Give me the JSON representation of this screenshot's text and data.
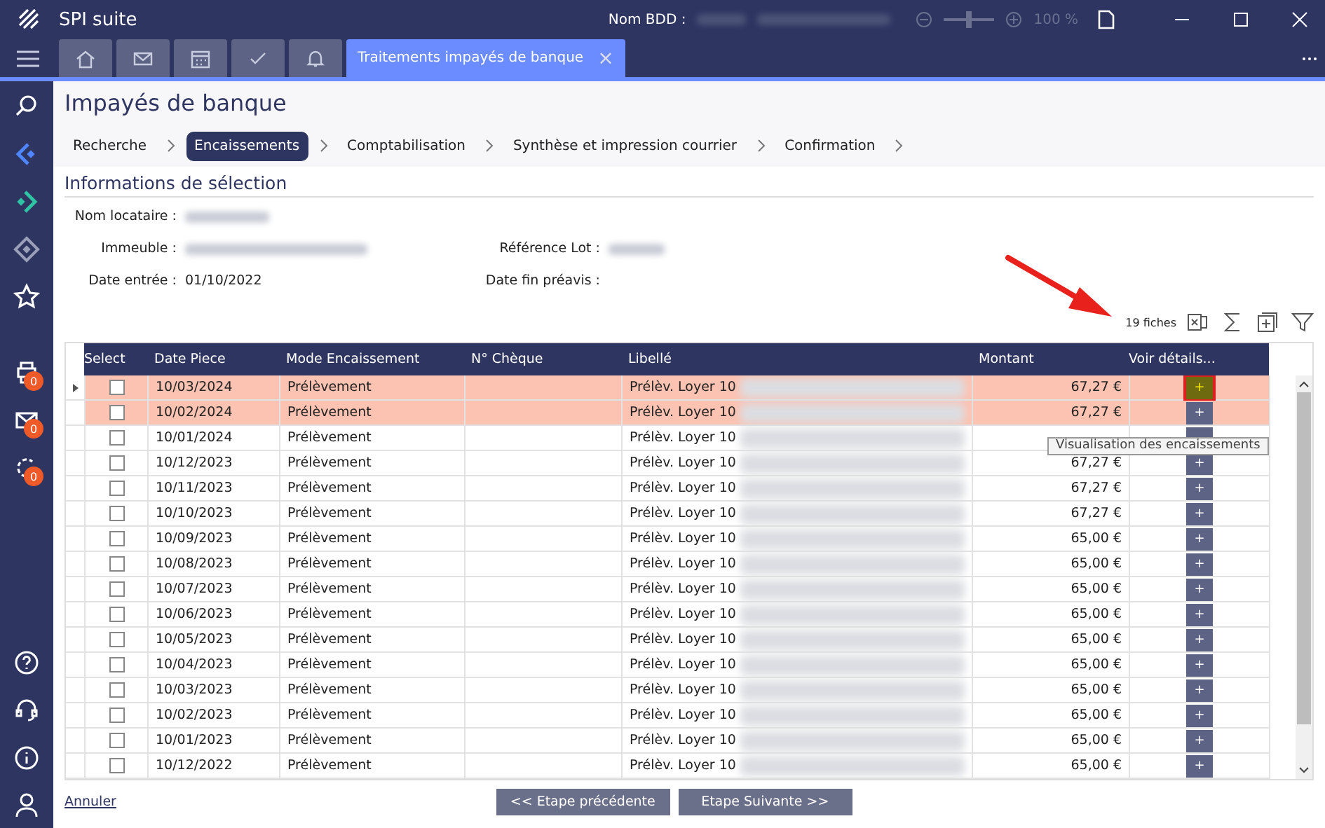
{
  "window": {
    "title": "SPI suite",
    "db_label": "Nom BDD :",
    "zoom": {
      "level": 0.5,
      "reading": "100 %"
    }
  },
  "tabs": [
    {
      "kind": "home",
      "selected": false
    },
    {
      "kind": "mail",
      "selected": false
    },
    {
      "kind": "calendar",
      "selected": false
    },
    {
      "kind": "check",
      "selected": false
    },
    {
      "kind": "bell",
      "selected": false
    },
    {
      "kind": "text",
      "label": "Traitements impayés de banque",
      "close": "×",
      "selected": true
    }
  ],
  "sidebar": {
    "items": [
      {
        "kind": "search"
      },
      {
        "kind": "back"
      },
      {
        "kind": "forward"
      },
      {
        "kind": "diamond"
      },
      {
        "kind": "star"
      },
      {
        "kind": "printer",
        "badge": "0"
      },
      {
        "kind": "mail",
        "badge": "0"
      },
      {
        "kind": "refresh",
        "badge": "0"
      }
    ],
    "bottom_items": [
      {
        "kind": "help"
      },
      {
        "kind": "headset"
      },
      {
        "kind": "info"
      },
      {
        "kind": "user"
      }
    ]
  },
  "page_title": "Impayés de banque",
  "steps": [
    {
      "label": "Recherche",
      "selected": false
    },
    {
      "label": "Encaissements",
      "selected": true
    },
    {
      "label": "Comptabilisation",
      "selected": false
    },
    {
      "label": "Synthèse et impression courrier",
      "selected": false
    },
    {
      "label": "Confirmation",
      "selected": false
    }
  ],
  "section_title": "Informations de sélection",
  "fields": [
    {
      "label": "Nom locataire :",
      "blurred": true
    },
    {
      "label": "Immeuble :",
      "blurred": true
    },
    {
      "label": "Référence Lot :",
      "blurred": true
    },
    {
      "label": "Date entrée :",
      "value": "01/10/2022"
    },
    {
      "label": "Date fin préavis :"
    }
  ],
  "record_count": "19 fiches",
  "table": {
    "columns": [
      "Select",
      "Date Piece",
      "Mode Encaissement",
      "N° Chèque",
      "Libellé",
      "Montant",
      "Voir détails..."
    ],
    "rows": [
      {
        "current": true,
        "selected": true,
        "checked": false,
        "date": "10/03/2024",
        "mode": "Prélèvement",
        "libelle": "Prélèv. Loyer 10",
        "montant": "67,27 €",
        "button": "+",
        "hovered": true
      },
      {
        "current": false,
        "selected": true,
        "checked": false,
        "date": "10/02/2024",
        "mode": "Prélèvement",
        "libelle": "Prélèv. Loyer 10",
        "montant": "67,27 €",
        "button": "+",
        "hovered": false
      },
      {
        "current": false,
        "selected": false,
        "checked": false,
        "date": "10/01/2024",
        "mode": "Prélèvement",
        "libelle": "Prélèv. Loyer 10",
        "hovered": false
      },
      {
        "current": false,
        "selected": false,
        "checked": false,
        "date": "10/12/2023",
        "mode": "Prélèvement",
        "libelle": "Prélèv. Loyer 10",
        "montant": "67,27 €",
        "button": "+",
        "hovered": false
      },
      {
        "current": false,
        "selected": false,
        "checked": false,
        "date": "10/11/2023",
        "mode": "Prélèvement",
        "libelle": "Prélèv. Loyer 10",
        "montant": "67,27 €",
        "button": "+",
        "hovered": false
      },
      {
        "current": false,
        "selected": false,
        "checked": false,
        "date": "10/10/2023",
        "mode": "Prélèvement",
        "libelle": "Prélèv. Loyer 10",
        "montant": "67,27 €",
        "button": "+",
        "hovered": false
      },
      {
        "current": false,
        "selected": false,
        "checked": false,
        "date": "10/09/2023",
        "mode": "Prélèvement",
        "libelle": "Prélèv. Loyer 10",
        "montant": "65,00 €",
        "button": "+",
        "hovered": false
      },
      {
        "current": false,
        "selected": false,
        "checked": false,
        "date": "10/08/2023",
        "mode": "Prélèvement",
        "libelle": "Prélèv. Loyer 10",
        "montant": "65,00 €",
        "button": "+",
        "hovered": false
      },
      {
        "current": false,
        "selected": false,
        "checked": false,
        "date": "10/07/2023",
        "mode": "Prélèvement",
        "libelle": "Prélèv. Loyer 10",
        "montant": "65,00 €",
        "button": "+",
        "hovered": false
      },
      {
        "current": false,
        "selected": false,
        "checked": false,
        "date": "10/06/2023",
        "mode": "Prélèvement",
        "libelle": "Prélèv. Loyer 10",
        "montant": "65,00 €",
        "button": "+",
        "hovered": false
      },
      {
        "current": false,
        "selected": false,
        "checked": false,
        "date": "10/05/2023",
        "mode": "Prélèvement",
        "libelle": "Prélèv. Loyer 10",
        "montant": "65,00 €",
        "button": "+",
        "hovered": false
      },
      {
        "current": false,
        "selected": false,
        "checked": false,
        "date": "10/04/2023",
        "mode": "Prélèvement",
        "libelle": "Prélèv. Loyer 10",
        "montant": "65,00 €",
        "button": "+",
        "hovered": false
      },
      {
        "current": false,
        "selected": false,
        "checked": false,
        "date": "10/03/2023",
        "mode": "Prélèvement",
        "libelle": "Prélèv. Loyer 10",
        "montant": "65,00 €",
        "button": "+",
        "hovered": false
      },
      {
        "current": false,
        "selected": false,
        "checked": false,
        "date": "10/02/2023",
        "mode": "Prélèvement",
        "libelle": "Prélèv. Loyer 10",
        "montant": "65,00 €",
        "button": "+",
        "hovered": false
      },
      {
        "current": false,
        "selected": false,
        "checked": false,
        "date": "10/01/2023",
        "mode": "Prélèvement",
        "libelle": "Prélèv. Loyer 10",
        "montant": "65,00 €",
        "button": "+",
        "hovered": false
      },
      {
        "current": false,
        "selected": false,
        "checked": false,
        "date": "10/12/2022",
        "mode": "Prélèvement",
        "libelle": "Prélèv. Loyer 10",
        "montant": "65,00 €",
        "button": "+",
        "hovered": false
      }
    ]
  },
  "tooltip": "Visualisation des encaissements",
  "footer": {
    "cancel": "Annuler",
    "buttons": [
      "<< Etape précédente",
      "Etape Suivante >>"
    ]
  }
}
